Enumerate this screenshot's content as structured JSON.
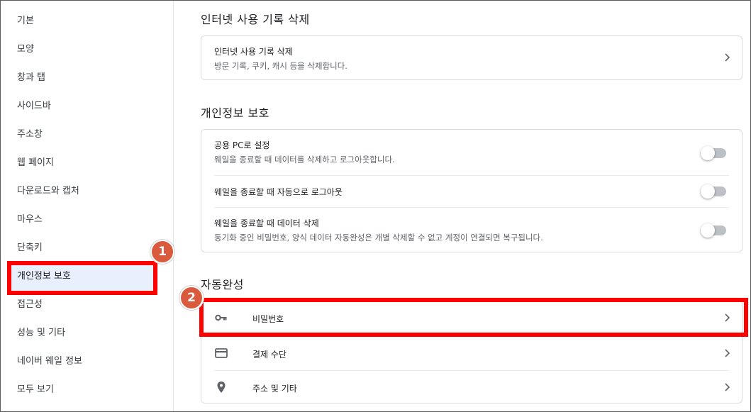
{
  "sidebar": {
    "items": [
      {
        "label": "기본"
      },
      {
        "label": "모양"
      },
      {
        "label": "창과 탭"
      },
      {
        "label": "사이드바"
      },
      {
        "label": "주소창"
      },
      {
        "label": "웹 페이지"
      },
      {
        "label": "다운로드와 캡처"
      },
      {
        "label": "마우스"
      },
      {
        "label": "단축키"
      },
      {
        "label": "개인정보 보호"
      },
      {
        "label": "접근성"
      },
      {
        "label": "성능 및 기타"
      },
      {
        "label": "네이버 웨일 정보"
      },
      {
        "label": "모두 보기"
      }
    ],
    "active_index": 9
  },
  "sections": {
    "history": {
      "title": "인터넷 사용 기록 삭제",
      "row_title": "인터넷 사용 기록 삭제",
      "row_sub": "방문 기록, 쿠키, 캐시 등을 삭제합니다."
    },
    "privacy": {
      "title": "개인정보 보호",
      "rows": [
        {
          "title": "공용 PC로 설정",
          "sub": "웨일을 종료할 때 데이터를 삭제하고 로그아웃합니다.",
          "on": false
        },
        {
          "title": "웨일을 종료할 때 자동으로 로그아웃",
          "sub": "",
          "on": false
        },
        {
          "title": "웨일을 종료할 때 데이터 삭제",
          "sub": "동기화 중인 비밀번호, 양식 데이터 자동완성은 개별 삭제할 수 없고 계정이 연결되면 복구됩니다.",
          "on": false
        }
      ]
    },
    "autofill": {
      "title": "자동완성",
      "rows": [
        {
          "label": "비밀번호",
          "icon": "key-icon"
        },
        {
          "label": "결제 수단",
          "icon": "credit-card-icon"
        },
        {
          "label": "주소 및 기타",
          "icon": "location-pin-icon"
        }
      ]
    }
  },
  "annotations": {
    "step1": "1",
    "step2": "2",
    "highlight_color": "#ff0000",
    "badge_color": "#d95a3d"
  }
}
